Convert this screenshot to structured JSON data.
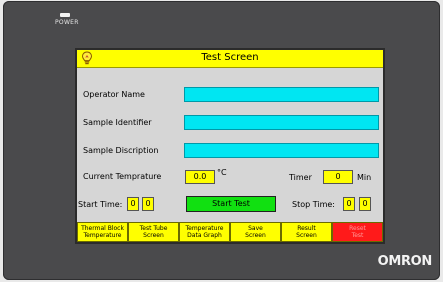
{
  "device": {
    "power_label": "POWER",
    "brand": "OMRON"
  },
  "screen": {
    "title": "Test Screen",
    "fields": [
      {
        "label": "Operator Name"
      },
      {
        "label": "Sample Identifier"
      },
      {
        "label": "Sample Discription"
      }
    ],
    "temperature": {
      "label": "Current Temprature",
      "value": "0.0",
      "unit": "°C"
    },
    "timer": {
      "label": "Timer",
      "value": "0",
      "unit": "Min"
    },
    "start_time": {
      "label": "Start Time:",
      "h": "0",
      "m": "0"
    },
    "stop_time": {
      "label": "Stop Time:",
      "h": "0",
      "m": "0"
    },
    "start_button": "Start Test",
    "nav": [
      {
        "line1": "Thermal Block",
        "line2": "Temperature"
      },
      {
        "line1": "Test Tube",
        "line2": "Screen"
      },
      {
        "line1": "Temperature",
        "line2": "Data Graph"
      },
      {
        "line1": "Save",
        "line2": "Screen"
      },
      {
        "line1": "Result",
        "line2": "Screen"
      },
      {
        "line1": "Reset",
        "line2": "Test"
      }
    ]
  },
  "colors": {
    "title_bar": "#ffff00",
    "input_fill": "#00e6f2",
    "start_button": "#11e011",
    "reset_button": "#ff1a1a"
  }
}
